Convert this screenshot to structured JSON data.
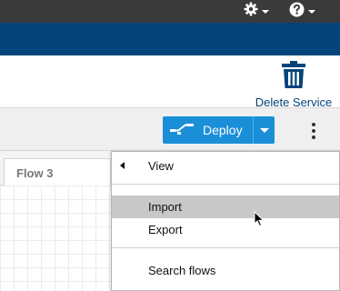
{
  "topbar": {
    "settings_icon": "gear-icon",
    "help_icon": "help-icon"
  },
  "service": {
    "delete_label": "Delete Service",
    "delete_icon": "trash-icon"
  },
  "toolbar": {
    "deploy_label": "Deploy",
    "deploy_icon": "deploy-icon",
    "menu_icon": "kebab-icon"
  },
  "tabs": [
    {
      "label": "Flow 3"
    }
  ],
  "menu": {
    "view_label": "View",
    "import_label": "Import",
    "export_label": "Export",
    "search_label": "Search flows",
    "active_item": "Import"
  },
  "colors": {
    "topbar": "#3a3a3a",
    "header": "#05447a",
    "deploy": "#1a8fd8",
    "hover": "#c8c8c8"
  }
}
